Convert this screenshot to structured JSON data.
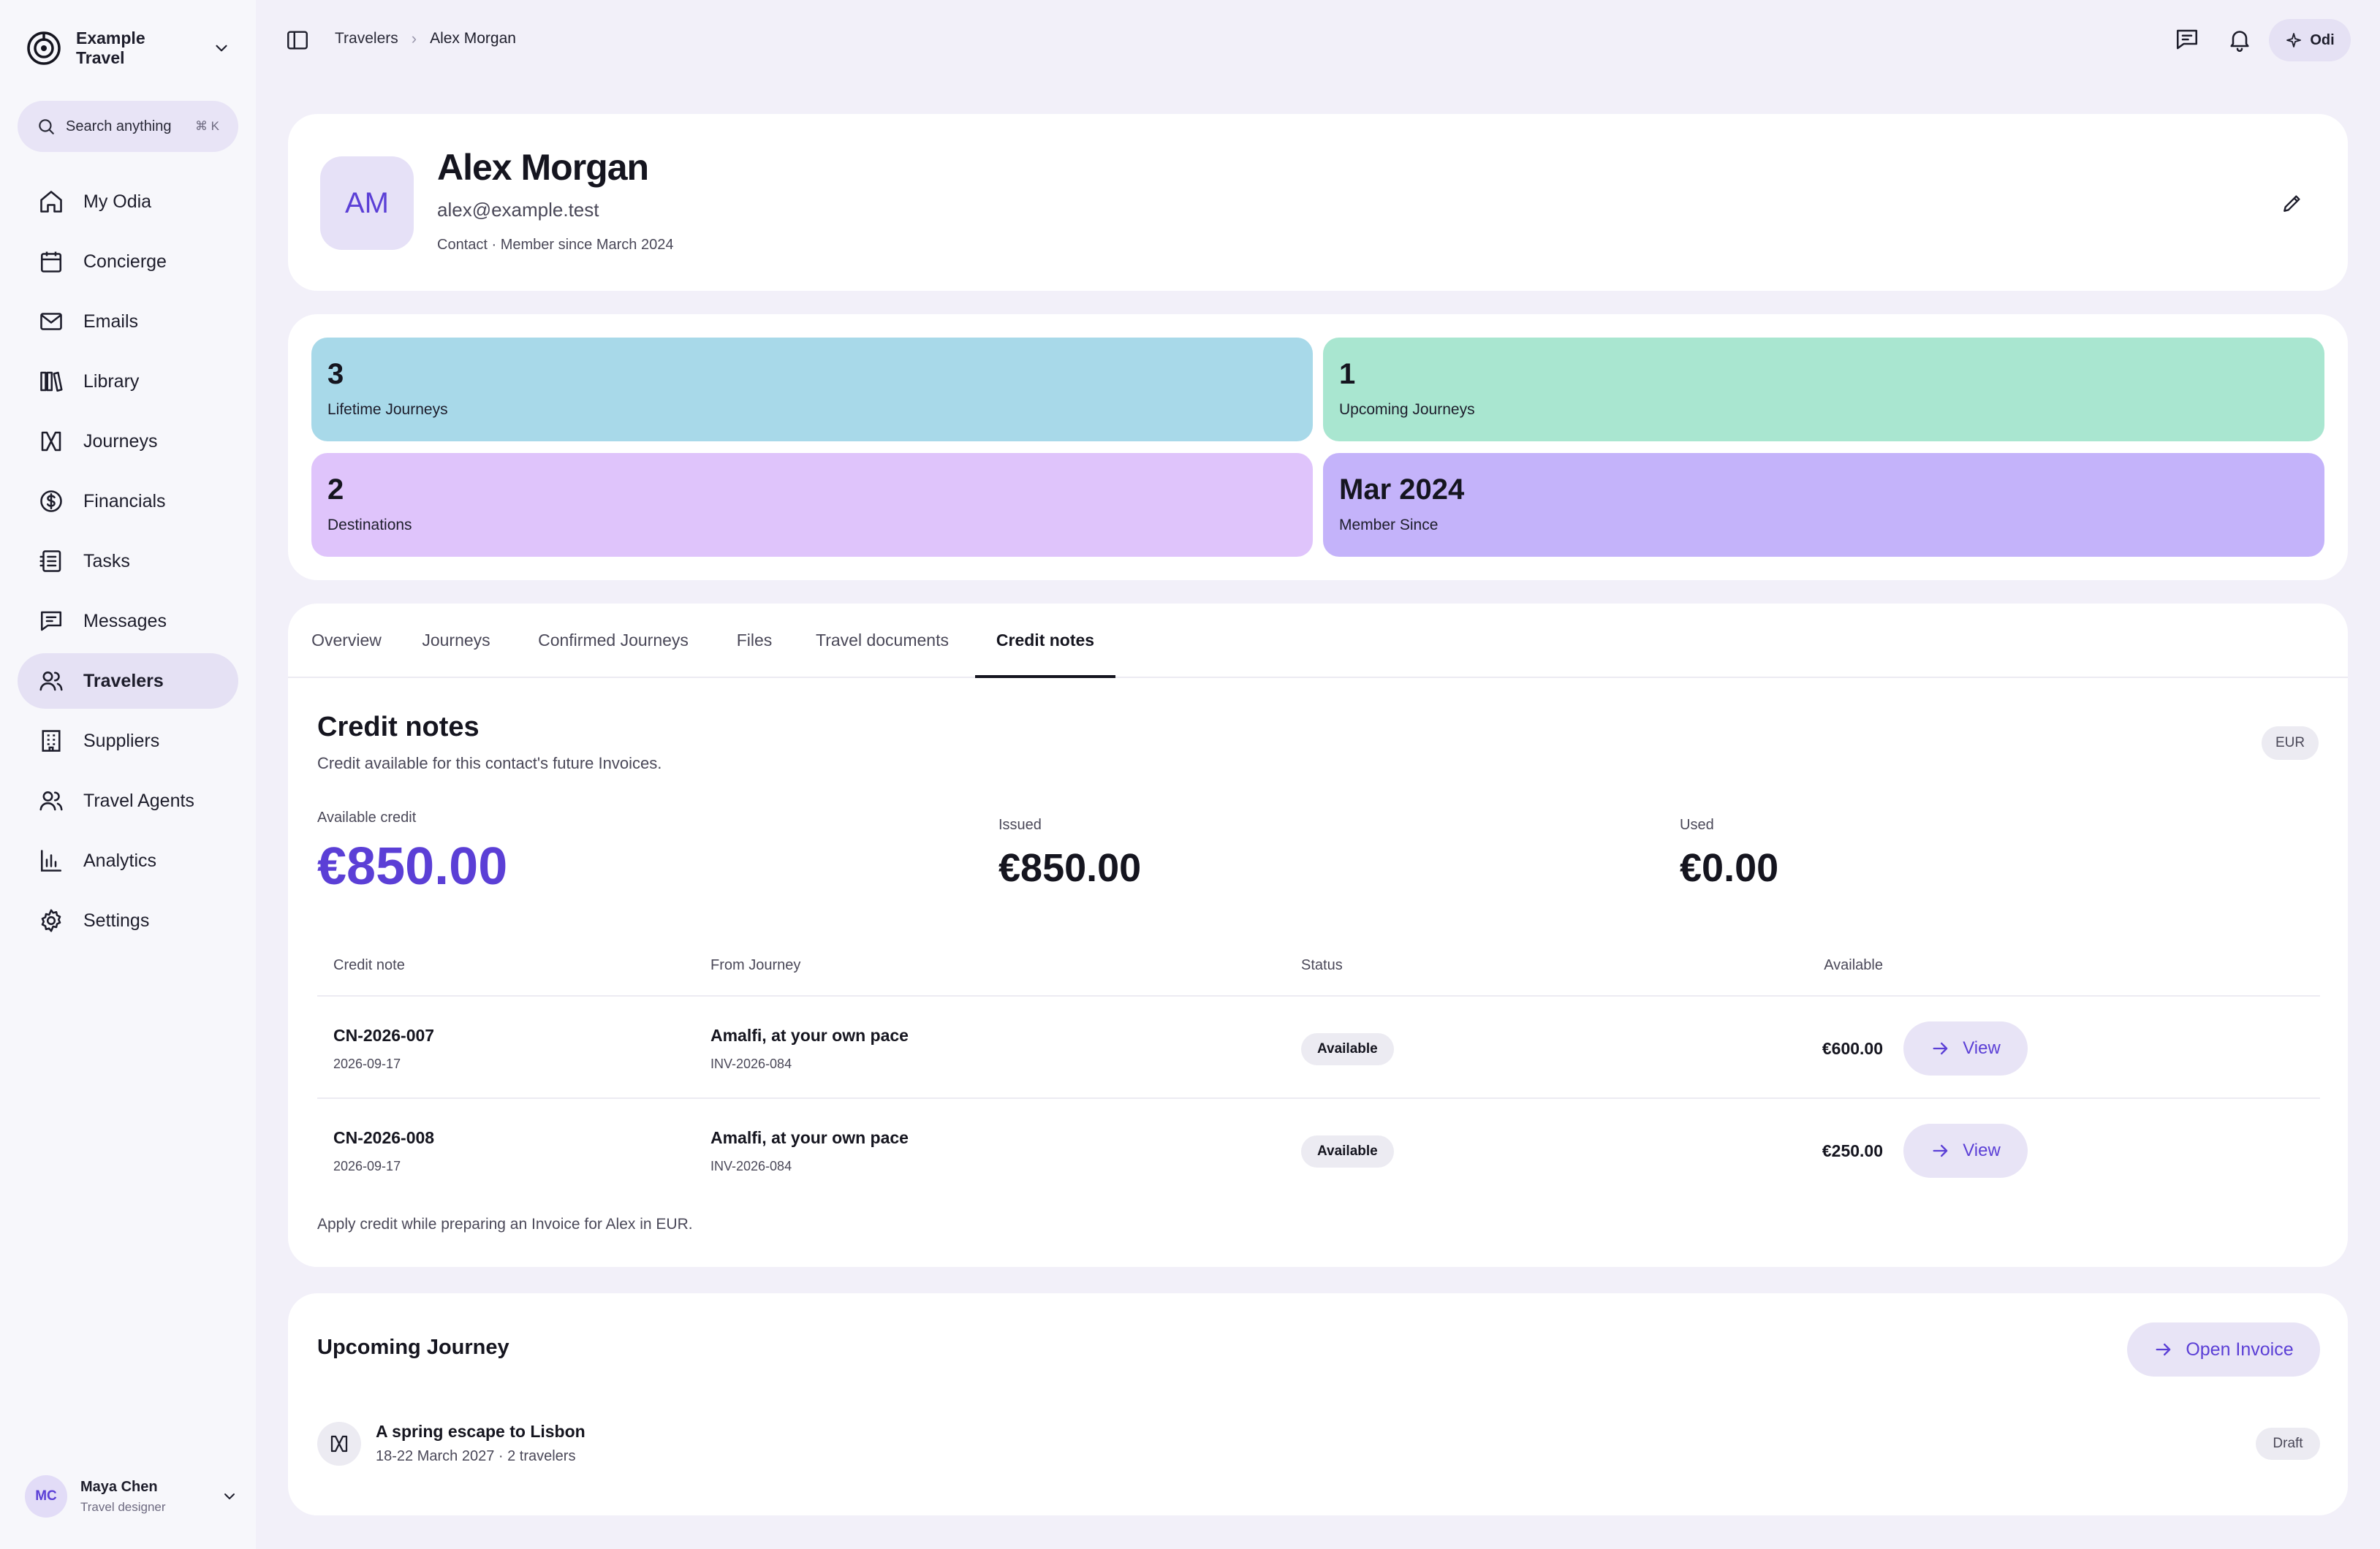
{
  "workspace": {
    "name": "Example Travel"
  },
  "search": {
    "placeholder": "Search anything",
    "shortcut": "⌘ K"
  },
  "sidebar": {
    "items": [
      {
        "label": "My Odia",
        "icon": "home-icon"
      },
      {
        "label": "Concierge",
        "icon": "calendar-icon"
      },
      {
        "label": "Emails",
        "icon": "mail-icon"
      },
      {
        "label": "Library",
        "icon": "library-icon"
      },
      {
        "label": "Journeys",
        "icon": "journey-icon"
      },
      {
        "label": "Financials",
        "icon": "dollar-icon"
      },
      {
        "label": "Tasks",
        "icon": "tasks-icon"
      },
      {
        "label": "Messages",
        "icon": "message-icon"
      },
      {
        "label": "Travelers",
        "icon": "users-icon",
        "active": true
      },
      {
        "label": "Suppliers",
        "icon": "building-icon"
      },
      {
        "label": "Travel Agents",
        "icon": "user-icon"
      },
      {
        "label": "Analytics",
        "icon": "chart-icon"
      },
      {
        "label": "Settings",
        "icon": "gear-icon"
      }
    ]
  },
  "user": {
    "initials": "MC",
    "name": "Maya Chen",
    "role": "Travel designer"
  },
  "breadcrumb": {
    "parent": "Travelers",
    "separator": "›",
    "current": "Alex Morgan"
  },
  "topbar": {
    "odi_label": "Odi"
  },
  "profile": {
    "initials": "AM",
    "name": "Alex Morgan",
    "email": "alex@example.test",
    "meta": "Contact · Member since March 2024"
  },
  "stats": [
    {
      "value": "3",
      "label": "Lifetime Journeys",
      "color": "#a8d9e9"
    },
    {
      "value": "1",
      "label": "Upcoming Journeys",
      "color": "#a9e6d0"
    },
    {
      "value": "2",
      "label": "Destinations",
      "color": "#dfc4fb"
    },
    {
      "value": "Mar 2024",
      "label": "Member Since",
      "color": "#c4b3fa"
    }
  ],
  "tabs": [
    {
      "label": "Overview"
    },
    {
      "label": "Journeys"
    },
    {
      "label": "Confirmed Journeys"
    },
    {
      "label": "Files"
    },
    {
      "label": "Travel documents"
    },
    {
      "label": "Credit notes",
      "active": true
    }
  ],
  "credit_notes": {
    "title": "Credit notes",
    "subtitle": "Credit available for this contact's future Invoices.",
    "currency": "EUR",
    "available_label": "Available credit",
    "available_value": "€850.00",
    "issued_label": "Issued",
    "issued_value": "€850.00",
    "used_label": "Used",
    "used_value": "€0.00",
    "columns": [
      "Credit note",
      "From Journey",
      "Status",
      "Available"
    ],
    "rows": [
      {
        "id": "CN-2026-007",
        "date": "2026-09-17",
        "journey": "Amalfi, at your own pace",
        "invoice": "INV-2026-084",
        "status": "Available",
        "amount": "€600.00",
        "action": "View"
      },
      {
        "id": "CN-2026-008",
        "date": "2026-09-17",
        "journey": "Amalfi, at your own pace",
        "invoice": "INV-2026-084",
        "status": "Available",
        "amount": "€250.00",
        "action": "View"
      }
    ],
    "footnote": "Apply credit while preparing an Invoice for Alex in EUR."
  },
  "upcoming": {
    "title": "Upcoming Journey",
    "button": "Open Invoice",
    "item": {
      "name": "A spring escape to Lisbon",
      "meta": "18-22 March 2027 · 2 travelers",
      "status": "Draft"
    }
  },
  "colors": {
    "accent": "#5b3fd6",
    "active_nav": "#e5e1f4",
    "page_bg": "#f2f0f9"
  }
}
